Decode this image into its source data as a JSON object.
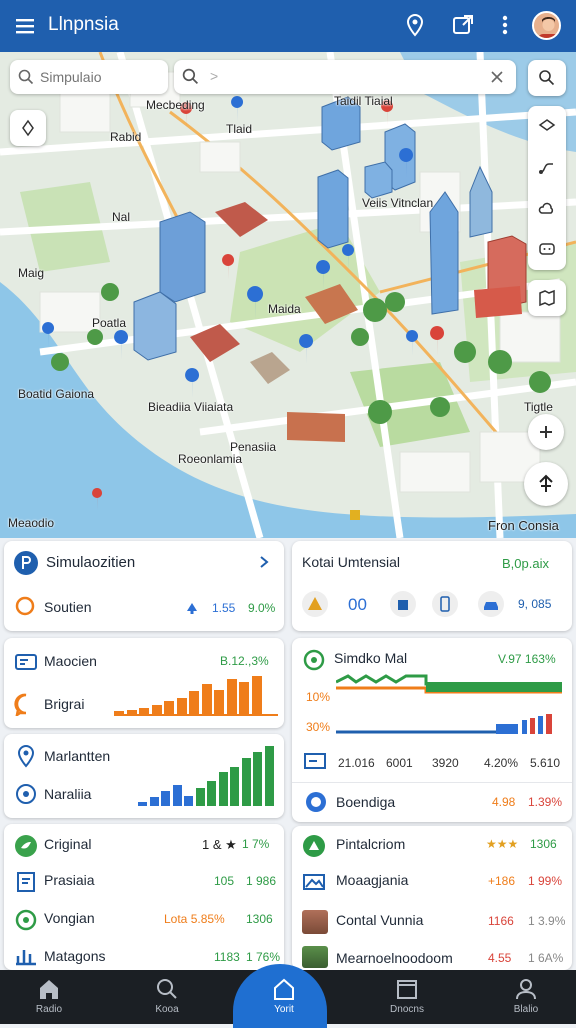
{
  "app": {
    "title": "Llnpnsia"
  },
  "search": {
    "left_placeholder": "Simpulaio",
    "right_value": ">"
  },
  "map_labels": [
    {
      "text": "Mecbeding"
    },
    {
      "text": "Tlaid"
    },
    {
      "text": "Taidil Tiaial"
    },
    {
      "text": "Rabid"
    },
    {
      "text": "Nal"
    },
    {
      "text": "Veiis Vitnclan"
    },
    {
      "text": "Maig"
    },
    {
      "text": "Poatla"
    },
    {
      "text": "Maida"
    },
    {
      "text": "Boatid Gaiona"
    },
    {
      "text": "Bieadiia Viiaiata"
    },
    {
      "text": "Penasiia"
    },
    {
      "text": "Roeonlamia"
    },
    {
      "text": "Tigtle"
    },
    {
      "text": "Meaodio"
    },
    {
      "text": "Fron Consia"
    }
  ],
  "panels": {
    "sim": {
      "title": "Simulaozitien",
      "row_label": "Soutien",
      "v1": "1.55",
      "v2": "9.0%"
    },
    "kota": {
      "title": "Kotai Umtensial",
      "value": "B,0p.aix",
      "count": "00",
      "v3": "9, 085"
    },
    "macien": {
      "title": "Maocien",
      "value": "B.12.,3%",
      "row_label": "Brigrai",
      "bars": [
        3,
        4,
        5,
        7,
        10,
        12,
        16,
        21,
        17,
        24,
        22,
        26
      ]
    },
    "sim_mal": {
      "title": "Simdko Mal",
      "value": "V.97 163%",
      "y1": "10%",
      "y2": "30%",
      "stats": [
        "21.016",
        "6001",
        "3920",
        "4.20%",
        "5.610"
      ],
      "footer_label": "Boendiga",
      "footer_v1": "4.98",
      "footer_v2": "1.39%"
    },
    "marl": {
      "title": "Marlantten",
      "row_label": "Naraliia",
      "bars": [
        3,
        6,
        10,
        14,
        7,
        12,
        17,
        23,
        26,
        32,
        36,
        40
      ]
    },
    "list_left": [
      {
        "label": "Criginal",
        "value": "1 & ★",
        "pct": "1 7%"
      },
      {
        "label": "Prasiaia",
        "value": "105",
        "pct": "1 986"
      },
      {
        "label": "Vongian",
        "value": "Lota  5.85%",
        "pct": "1306"
      },
      {
        "label": "Matagons",
        "value": "1183",
        "pct": "1 76%"
      }
    ],
    "list_right": [
      {
        "label": "Pintalcriom",
        "value": "★★★",
        "pct": "1306"
      },
      {
        "label": "Moaagjania",
        "value": "+186",
        "pct": "1 99%"
      },
      {
        "label": "Contal Vunnia",
        "value": "1166",
        "pct": "1 3.9%"
      },
      {
        "label": "Mearnoelnoodoom",
        "value": "4.55",
        "pct": "1 6A%"
      }
    ]
  },
  "nav": [
    {
      "label": "Radio"
    },
    {
      "label": "Kooa"
    },
    {
      "label": "Yorit"
    },
    {
      "label": "Dnocns"
    },
    {
      "label": "Blalio"
    }
  ],
  "colors": {
    "primary": "#1f5fae",
    "accent_green": "#2e9b46",
    "accent_orange": "#ef7d1a",
    "accent_blue": "#2c6fd4"
  }
}
